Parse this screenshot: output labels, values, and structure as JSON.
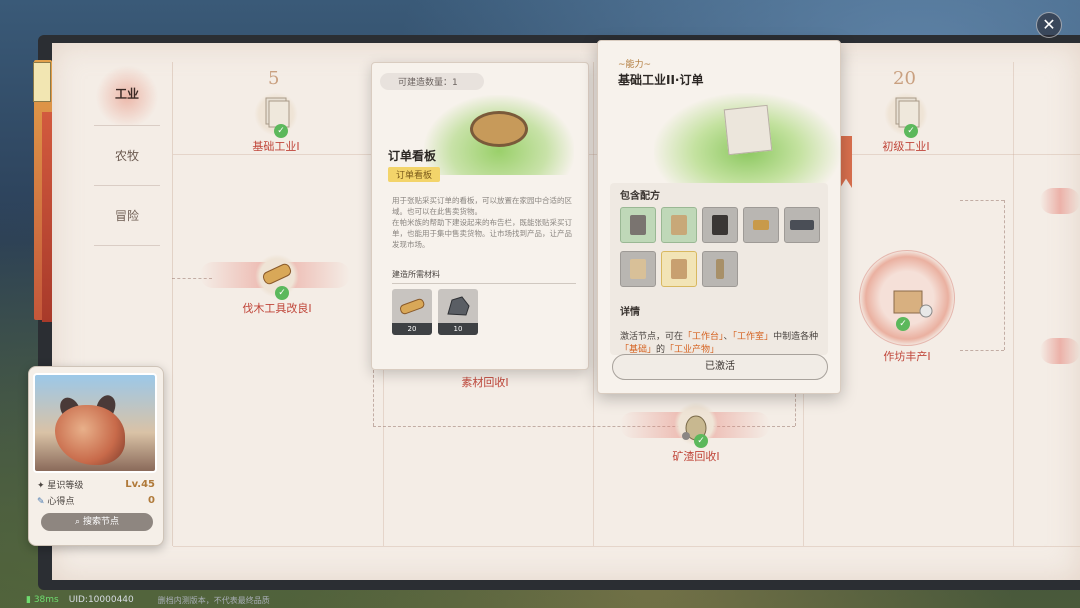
{
  "nav": {
    "items": [
      {
        "label": "工业",
        "active": true
      },
      {
        "label": "农牧",
        "active": false
      },
      {
        "label": "冒险",
        "active": false
      }
    ]
  },
  "tree": {
    "level_markers": [
      "5",
      "20"
    ],
    "nodes": {
      "basic_industry": {
        "label": "基础工业I",
        "unlocked": true
      },
      "junior_industry": {
        "label": "初级工业I",
        "unlocked": true
      },
      "logging_tool": {
        "label": "伐木工具改良I",
        "unlocked": true
      },
      "material_recycle": {
        "label": "素材回收I",
        "unlocked": false
      },
      "ore_recycle": {
        "label": "矿渣回收I",
        "unlocked": true
      },
      "workshop": {
        "label": "作坊丰产I",
        "unlocked": true
      }
    }
  },
  "item_card": {
    "buildable_count": "可建造数量：1",
    "title": "订单看板",
    "tag": "订单看板",
    "description": "用于张贴采买订单的看板，可以放置在家园中合适的区域。也可以在此售卖货物。\n在帕米族的帮助下建设起来的布告栏，既能张贴采买订单，也能用于集中售卖货物。让市场找到产品，让产品发现市场。",
    "materials_header": "建造所需材料",
    "materials": [
      {
        "name": "wood",
        "count": "20"
      },
      {
        "name": "stone",
        "count": "10"
      }
    ]
  },
  "ability_card": {
    "ability_label": "~能力~",
    "title": "基础工业II·订单",
    "recipes_header": "包含配方",
    "recipes": [
      {
        "name": "recipe-1",
        "style": "green"
      },
      {
        "name": "recipe-2",
        "style": "green"
      },
      {
        "name": "recipe-3",
        "style": "grey"
      },
      {
        "name": "recipe-4",
        "style": "grey"
      },
      {
        "name": "recipe-5",
        "style": "grey"
      },
      {
        "name": "recipe-6",
        "style": "grey"
      },
      {
        "name": "recipe-7",
        "style": "gold"
      },
      {
        "name": "recipe-8",
        "style": "grey"
      }
    ],
    "detail_header": "详情",
    "detail_prefix": "激活节点，可在",
    "detail_hl1": "「工作台」",
    "detail_mid1": "、",
    "detail_hl2": "「工作室」",
    "detail_mid2": "中制造各种",
    "detail_hl3": "「基础」",
    "detail_mid3": "的",
    "detail_hl4": "「工业产物」",
    "activated_label": "已激活"
  },
  "profile": {
    "rank_label": "星识等级",
    "rank_value": "Lv.45",
    "points_label": "心得点",
    "points_value": "0",
    "search_label": "搜索节点"
  },
  "footer": {
    "ping": "38ms",
    "uid": "UID:10000440",
    "notice": "删档内测版本，不代表最终品质"
  },
  "colors": {
    "accent": "#c0463a",
    "highlight": "#d5611f",
    "check": "#5cb85c"
  }
}
